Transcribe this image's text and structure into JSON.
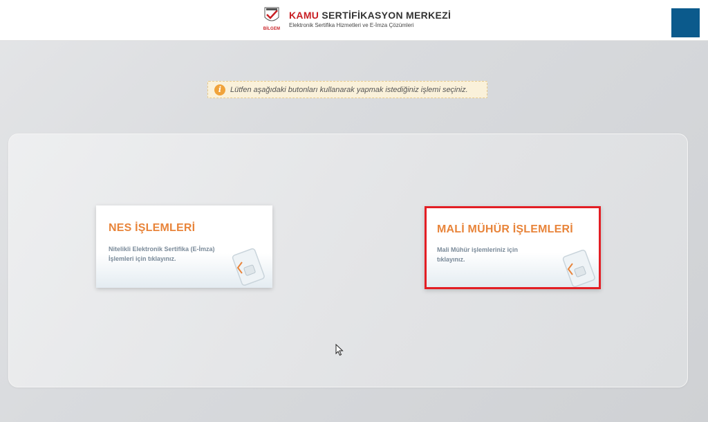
{
  "header": {
    "brand_title_part1": "KAMU",
    "brand_title_part2": "SERTİFİKASYON MERKEZİ",
    "brand_subtitle": "Elektronik Sertifika Hizmetleri ve E-İmza Çözümleri",
    "emblem_label": "BİLGEM",
    "corner_color": "#0b5a8c"
  },
  "notice": {
    "icon": "info-icon",
    "text": "Lütfen aşağıdaki butonları kullanarak yapmak istediğiniz işlemi seçiniz."
  },
  "cards": [
    {
      "title": "NES İŞLEMLERİ",
      "description_line1": "Nitelikli Elektronik Sertifika (E-İmza)",
      "description_line2": "İşlemleri için tıklayınız.",
      "icon": "smart-card-icon",
      "highlighted": false
    },
    {
      "title": "MALİ MÜHÜR İŞLEMLERİ",
      "description_line1": "Mali Mühür işlemleriniz için",
      "description_line2": "tıklayınız.",
      "icon": "smart-card-icon",
      "highlighted": true,
      "highlight_color": "#e31e24"
    }
  ],
  "colors": {
    "accent_orange": "#e8843a",
    "brand_red": "#c81e23"
  }
}
